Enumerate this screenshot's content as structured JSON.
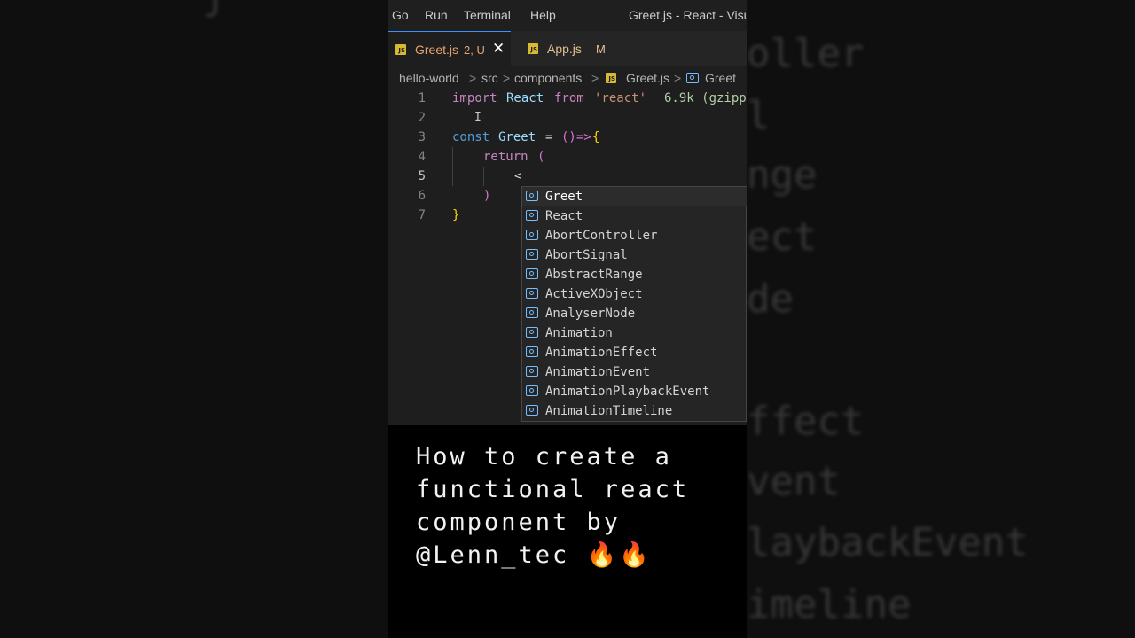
{
  "menu": [
    "Go",
    "Run",
    "Terminal",
    "Help"
  ],
  "window_title": "Greet.js - React - Visua",
  "tabs": [
    {
      "icon": "JS",
      "label": "Greet.js",
      "status": "2, U",
      "color": "#e6a56f",
      "active": true
    },
    {
      "icon": "JS",
      "label": "App.js",
      "status": "M",
      "color": "#e2c08d",
      "active": false
    }
  ],
  "breadcrumb": {
    "items": [
      "hello-world",
      "src",
      "components",
      "Greet.js",
      "Greet"
    ],
    "separator": ">"
  },
  "editor": {
    "line_numbers": [
      "1",
      "2",
      "3",
      "4",
      "5",
      "6",
      "7"
    ],
    "line1": {
      "kw": "import",
      "ident": "React",
      "from": "from",
      "str": "'react'",
      "hint": "6.9k (gzipp"
    },
    "line3": {
      "kw": "const",
      "name": "Greet",
      "eq": "=",
      "arrow": "()=>",
      "brace": "{"
    },
    "line4": {
      "kw": "return",
      "paren": "("
    },
    "line5": {
      "text": "<"
    },
    "line6": {
      "paren": ")"
    },
    "line7": {
      "brace": "}"
    }
  },
  "suggestions": [
    "Greet",
    "React",
    "AbortController",
    "AbortSignal",
    "AbstractRange",
    "ActiveXObject",
    "AnalyserNode",
    "Animation",
    "AnimationEffect",
    "AnimationEvent",
    "AnimationPlaybackEvent",
    "AnimationTimeline"
  ],
  "caption": "How to create a functional react component by @Lenn_tec 🔥🔥",
  "background_blur_text": {
    "left": [
      "j"
    ],
    "right": [
      "oller",
      "l",
      "nge",
      "ect",
      "de",
      "ffect",
      "vent",
      "laybackEvent",
      "imeline"
    ]
  },
  "colors": {
    "accent": "#3794ff",
    "editor_bg": "#1e1e1e",
    "js_icon": "#d7ba34"
  }
}
